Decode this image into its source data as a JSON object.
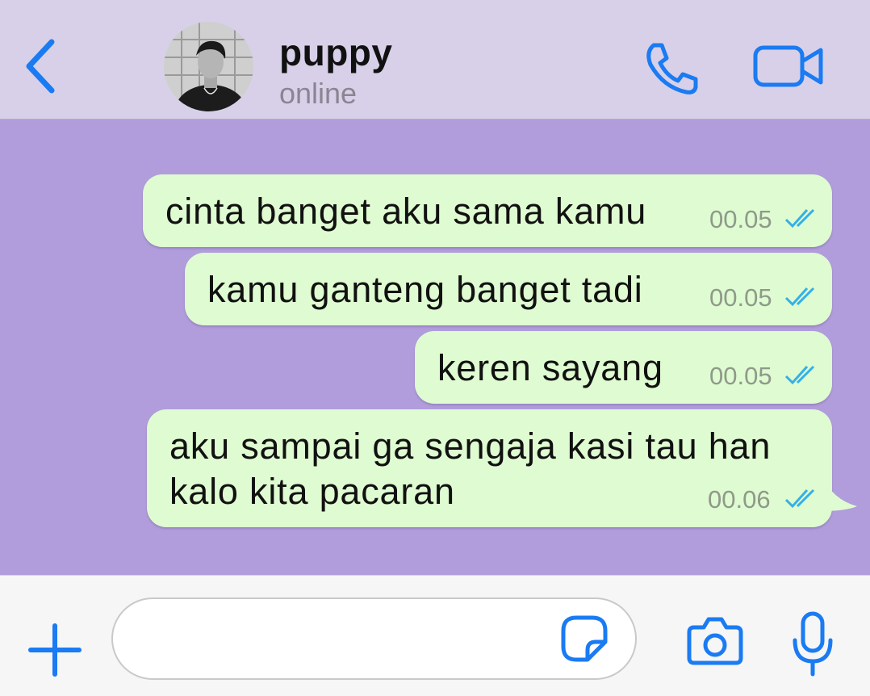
{
  "header": {
    "contact_name": "puppy",
    "status": "online",
    "icons": {
      "back": "chevron-left-icon",
      "call": "phone-icon",
      "video": "video-camera-icon"
    }
  },
  "messages": [
    {
      "text": "cinta banget aku sama kamu",
      "time": "00.05",
      "status": "read"
    },
    {
      "text": "kamu ganteng banget tadi",
      "time": "00.05",
      "status": "read"
    },
    {
      "text": "keren sayang",
      "time": "00.05",
      "status": "read"
    },
    {
      "text_lines": [
        "aku sampai ga sengaja kasi tau han",
        "kalo kita pacaran"
      ],
      "time": "00.06",
      "status": "read"
    }
  ],
  "input_bar": {
    "message_value": "",
    "icons": {
      "add": "plus-icon",
      "sticker": "sticker-icon",
      "camera": "camera-icon",
      "mic": "microphone-icon"
    }
  },
  "colors": {
    "accent": "#1a7bf2",
    "header_bg": "#d8d0e9",
    "chat_bg": "#b19ddb",
    "bubble_bg": "#dffbd1",
    "read_ticks": "#34b0e6",
    "time_text": "#8f9a8a"
  }
}
